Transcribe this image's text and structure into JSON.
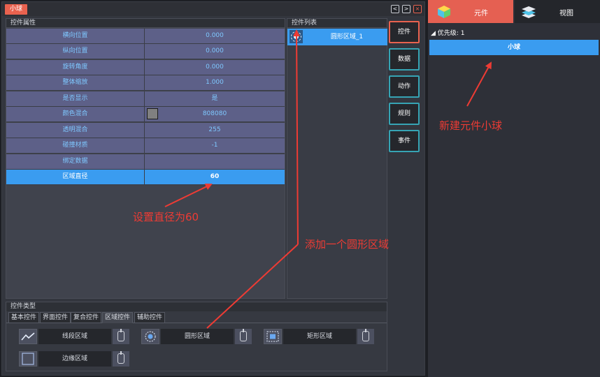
{
  "window": {
    "title": "小球",
    "btn_prev": "<",
    "btn_next": ">",
    "btn_close": "×"
  },
  "properties": {
    "header": "控件属性",
    "rows": [
      {
        "key": "横向位置",
        "value": "0.000"
      },
      {
        "key": "纵向位置",
        "value": "0.000"
      },
      {
        "key": "旋转角度",
        "value": "0.000"
      },
      {
        "key": "整体缩放",
        "value": "1.000"
      },
      {
        "key": "是否显示",
        "value": "是"
      },
      {
        "key": "颜色混合",
        "value": "808080",
        "swatch": "#808080"
      },
      {
        "key": "透明混合",
        "value": "255"
      },
      {
        "key": "碰撞材质",
        "value": "-1"
      },
      {
        "key": "绑定数据",
        "value": ""
      },
      {
        "key": "区域直径",
        "value": "60"
      }
    ],
    "selected_row": 9
  },
  "widget_list": {
    "header": "控件列表",
    "items": [
      {
        "label": "圆形区域_1",
        "icon": "circle-region-icon"
      }
    ]
  },
  "side_buttons": [
    "控件",
    "数据",
    "动作",
    "规则",
    "事件"
  ],
  "widget_types": {
    "header": "控件类型",
    "tabs": [
      "基本控件",
      "界面控件",
      "复合控件",
      "区域控件",
      "辅助控件"
    ],
    "active_tab": 3,
    "tools": [
      {
        "label": "线段区域",
        "icon": "line-segment-icon"
      },
      {
        "label": "圆形区域",
        "icon": "circle-region-icon"
      },
      {
        "label": "矩形区域",
        "icon": "rect-region-icon"
      },
      {
        "label": "边缘区域",
        "icon": "edge-region-icon"
      }
    ]
  },
  "component_panel": {
    "tabs": [
      {
        "label": "元件",
        "icon": "cube-icon"
      },
      {
        "label": "视图",
        "icon": "layers-icon"
      }
    ],
    "priority_label": "优先级: 1",
    "items": [
      "小球"
    ]
  },
  "annotations": {
    "new_component": "新建元件小球",
    "set_diameter": "设置直径为60",
    "add_circle": "添加一个圆形区域"
  },
  "colors": {
    "accent": "#e9624f",
    "selection": "#3a9cf0",
    "annotation": "#ee3b34"
  }
}
